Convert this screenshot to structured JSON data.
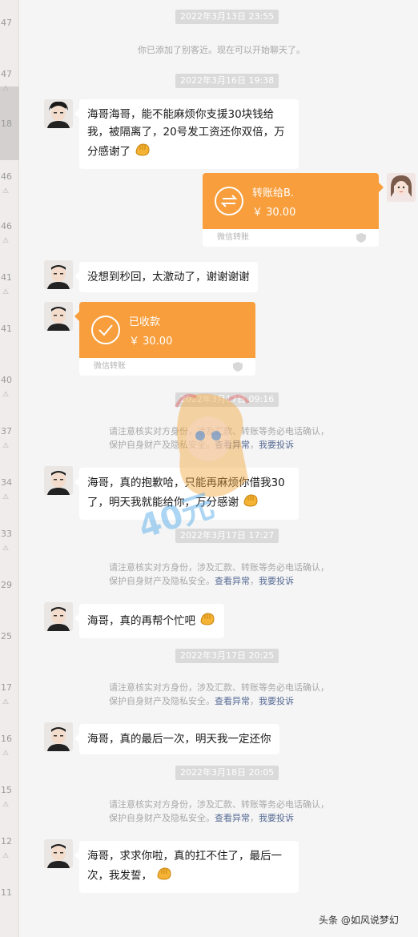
{
  "sidebar": {
    "numbers": [
      "47",
      "47",
      "18",
      "46",
      "46",
      "41",
      "41",
      "40",
      "37",
      "34",
      "33",
      "29",
      "25",
      "17",
      "16",
      "15",
      "12",
      "11"
    ]
  },
  "timestamps": [
    "2022年3月13日 23:55",
    "2022年3月16日 19:38",
    "2022年3月17日 09:16",
    "2022年3月17日 17:27",
    "2022年3月17日 20:25",
    "2022年3月18日 20:05"
  ],
  "system": {
    "added_friend": "你已添加了别客近。现在可以开始聊天了。",
    "warn_line1": "请注意核实对方身份，涉及汇款、转账等务必电话确认，",
    "warn_line2_prefix": "保护自身财产及隐私安全。",
    "link_check": "查看异常",
    "link_report": "我要投诉"
  },
  "messages": {
    "m1": "海哥海哥，能不能麻烦你支援30块钱给我，被隔离了，20号发工资还你双倍，万分感谢了",
    "m2": "没想到秒回，太激动了，谢谢谢谢",
    "m3": "海哥，真的抱歉哈，只能再麻烦你借我30了，明天我就能给你，万分感谢",
    "m4": "海哥，真的再帮个忙吧",
    "m5": "海哥，真的最后一次，明天我一定还你",
    "m6": "海哥，求求你啦，真的扛不住了，最后一次，我发誓，"
  },
  "transfer_sent": {
    "label": "转账给B.",
    "amount": "￥ 30.00",
    "footer": "微信转账"
  },
  "transfer_received": {
    "label": "已收款",
    "amount": "￥ 30.00",
    "footer": "微信转账"
  },
  "watermark": "头条 @如风说梦幻",
  "sticker_text": "40元",
  "colors": {
    "transfer": "#f89e3c",
    "link": "#576b95",
    "timestamp_bg": "#dadada"
  }
}
